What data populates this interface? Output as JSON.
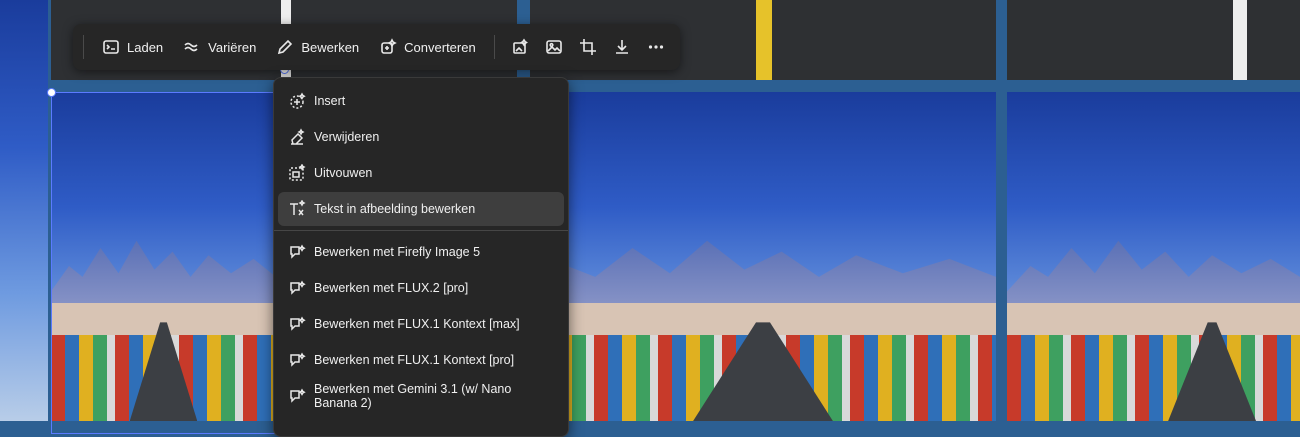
{
  "toolbar": {
    "buttons": [
      {
        "label": "Laden",
        "icon": "terminal-icon"
      },
      {
        "label": "Variëren",
        "icon": "wave-icon"
      },
      {
        "label": "Bewerken",
        "icon": "pencil-icon"
      },
      {
        "label": "Converteren",
        "icon": "convert-icon"
      }
    ],
    "icon_buttons": [
      "sparkle-image-icon",
      "image-icon",
      "crop-icon",
      "download-icon",
      "more-icon"
    ]
  },
  "menu": {
    "items": [
      {
        "label": "Insert",
        "icon": "insert-sparkle-icon"
      },
      {
        "label": "Verwijderen",
        "icon": "erase-icon"
      },
      {
        "label": "Uitvouwen",
        "icon": "expand-icon"
      },
      {
        "label": "Tekst in afbeelding bewerken",
        "icon": "text-edit-icon",
        "active": true
      }
    ],
    "model_items": [
      {
        "label": "Bewerken met Firefly Image 5",
        "icon": "chat-sparkle-icon"
      },
      {
        "label": "Bewerken met FLUX.2 [pro]",
        "icon": "chat-sparkle-icon"
      },
      {
        "label": "Bewerken met FLUX.1 Kontext [max]",
        "icon": "chat-sparkle-icon"
      },
      {
        "label": "Bewerken met FLUX.1 Kontext [pro]",
        "icon": "chat-sparkle-icon"
      },
      {
        "label": "Bewerken met Gemini 3.1 (w/ Nano Banana 2)",
        "icon": "chat-sparkle-icon"
      }
    ]
  },
  "colors": {
    "panel": "#262626",
    "selection": "#5b7bff",
    "active_item": "#3e3e3e"
  }
}
